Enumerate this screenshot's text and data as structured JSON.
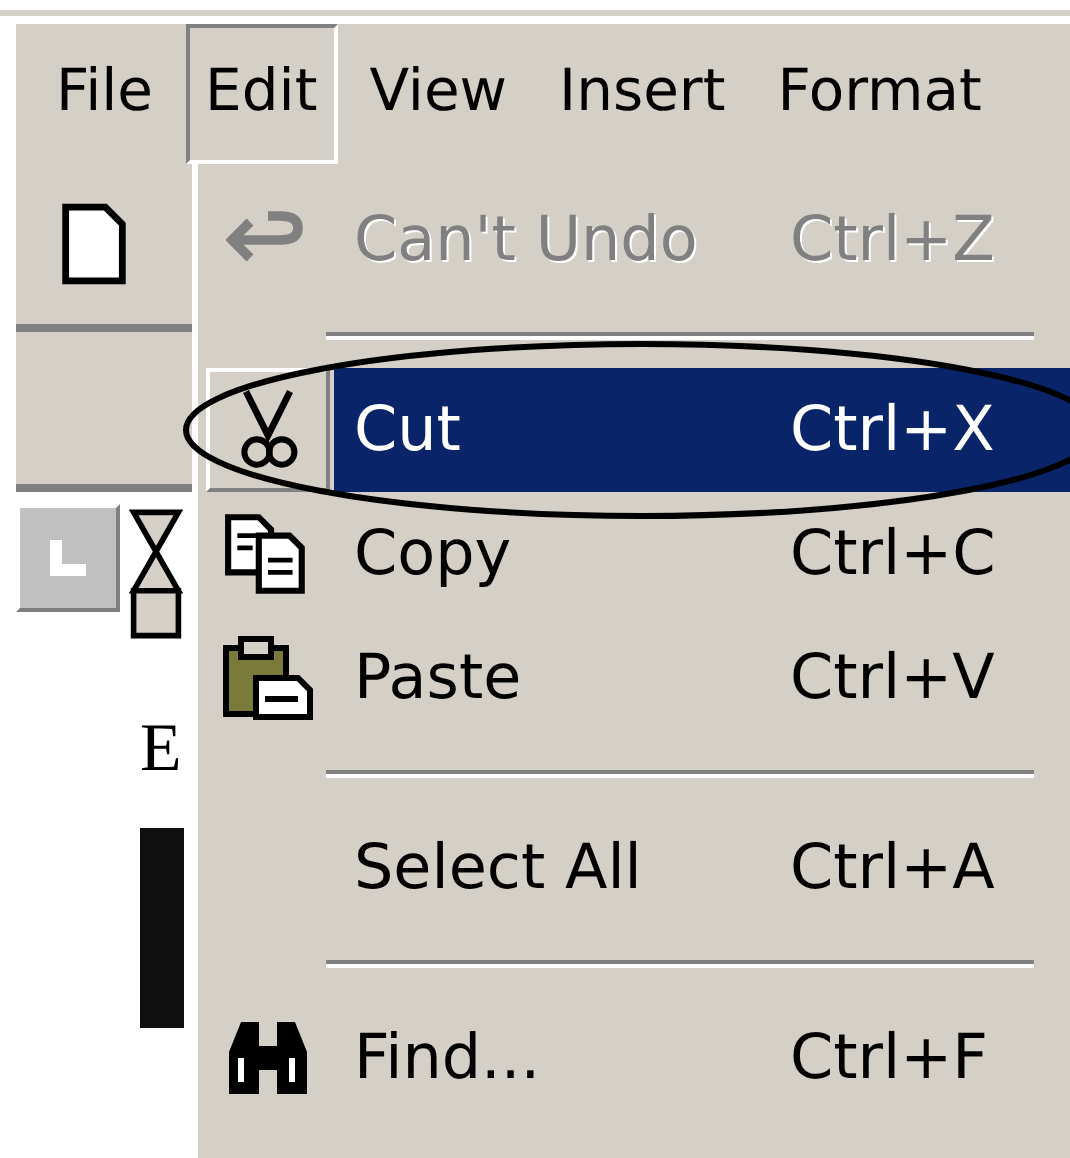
{
  "menubar": [
    {
      "label": "File",
      "selected": false
    },
    {
      "label": "Edit",
      "selected": true
    },
    {
      "label": "View",
      "selected": false
    },
    {
      "label": "Insert",
      "selected": false
    },
    {
      "label": "Format",
      "selected": false
    }
  ],
  "document": {
    "text": "E"
  },
  "edit_menu": [
    {
      "kind": "item",
      "label": "Can't Undo",
      "shortcut": "Ctrl+Z",
      "disabled": true,
      "selected": false
    },
    {
      "kind": "separator"
    },
    {
      "kind": "item",
      "label": "Cut",
      "shortcut": "Ctrl+X",
      "disabled": false,
      "selected": true
    },
    {
      "kind": "item",
      "label": "Copy",
      "shortcut": "Ctrl+C",
      "disabled": false,
      "selected": false
    },
    {
      "kind": "item",
      "label": "Paste",
      "shortcut": "Ctrl+V",
      "disabled": false,
      "selected": false
    },
    {
      "kind": "separator"
    },
    {
      "kind": "item",
      "label": "Select All",
      "shortcut": "Ctrl+A",
      "disabled": false,
      "selected": false
    },
    {
      "kind": "separator"
    },
    {
      "kind": "item",
      "label": "Find...",
      "shortcut": "Ctrl+F",
      "disabled": false,
      "selected": false
    }
  ]
}
